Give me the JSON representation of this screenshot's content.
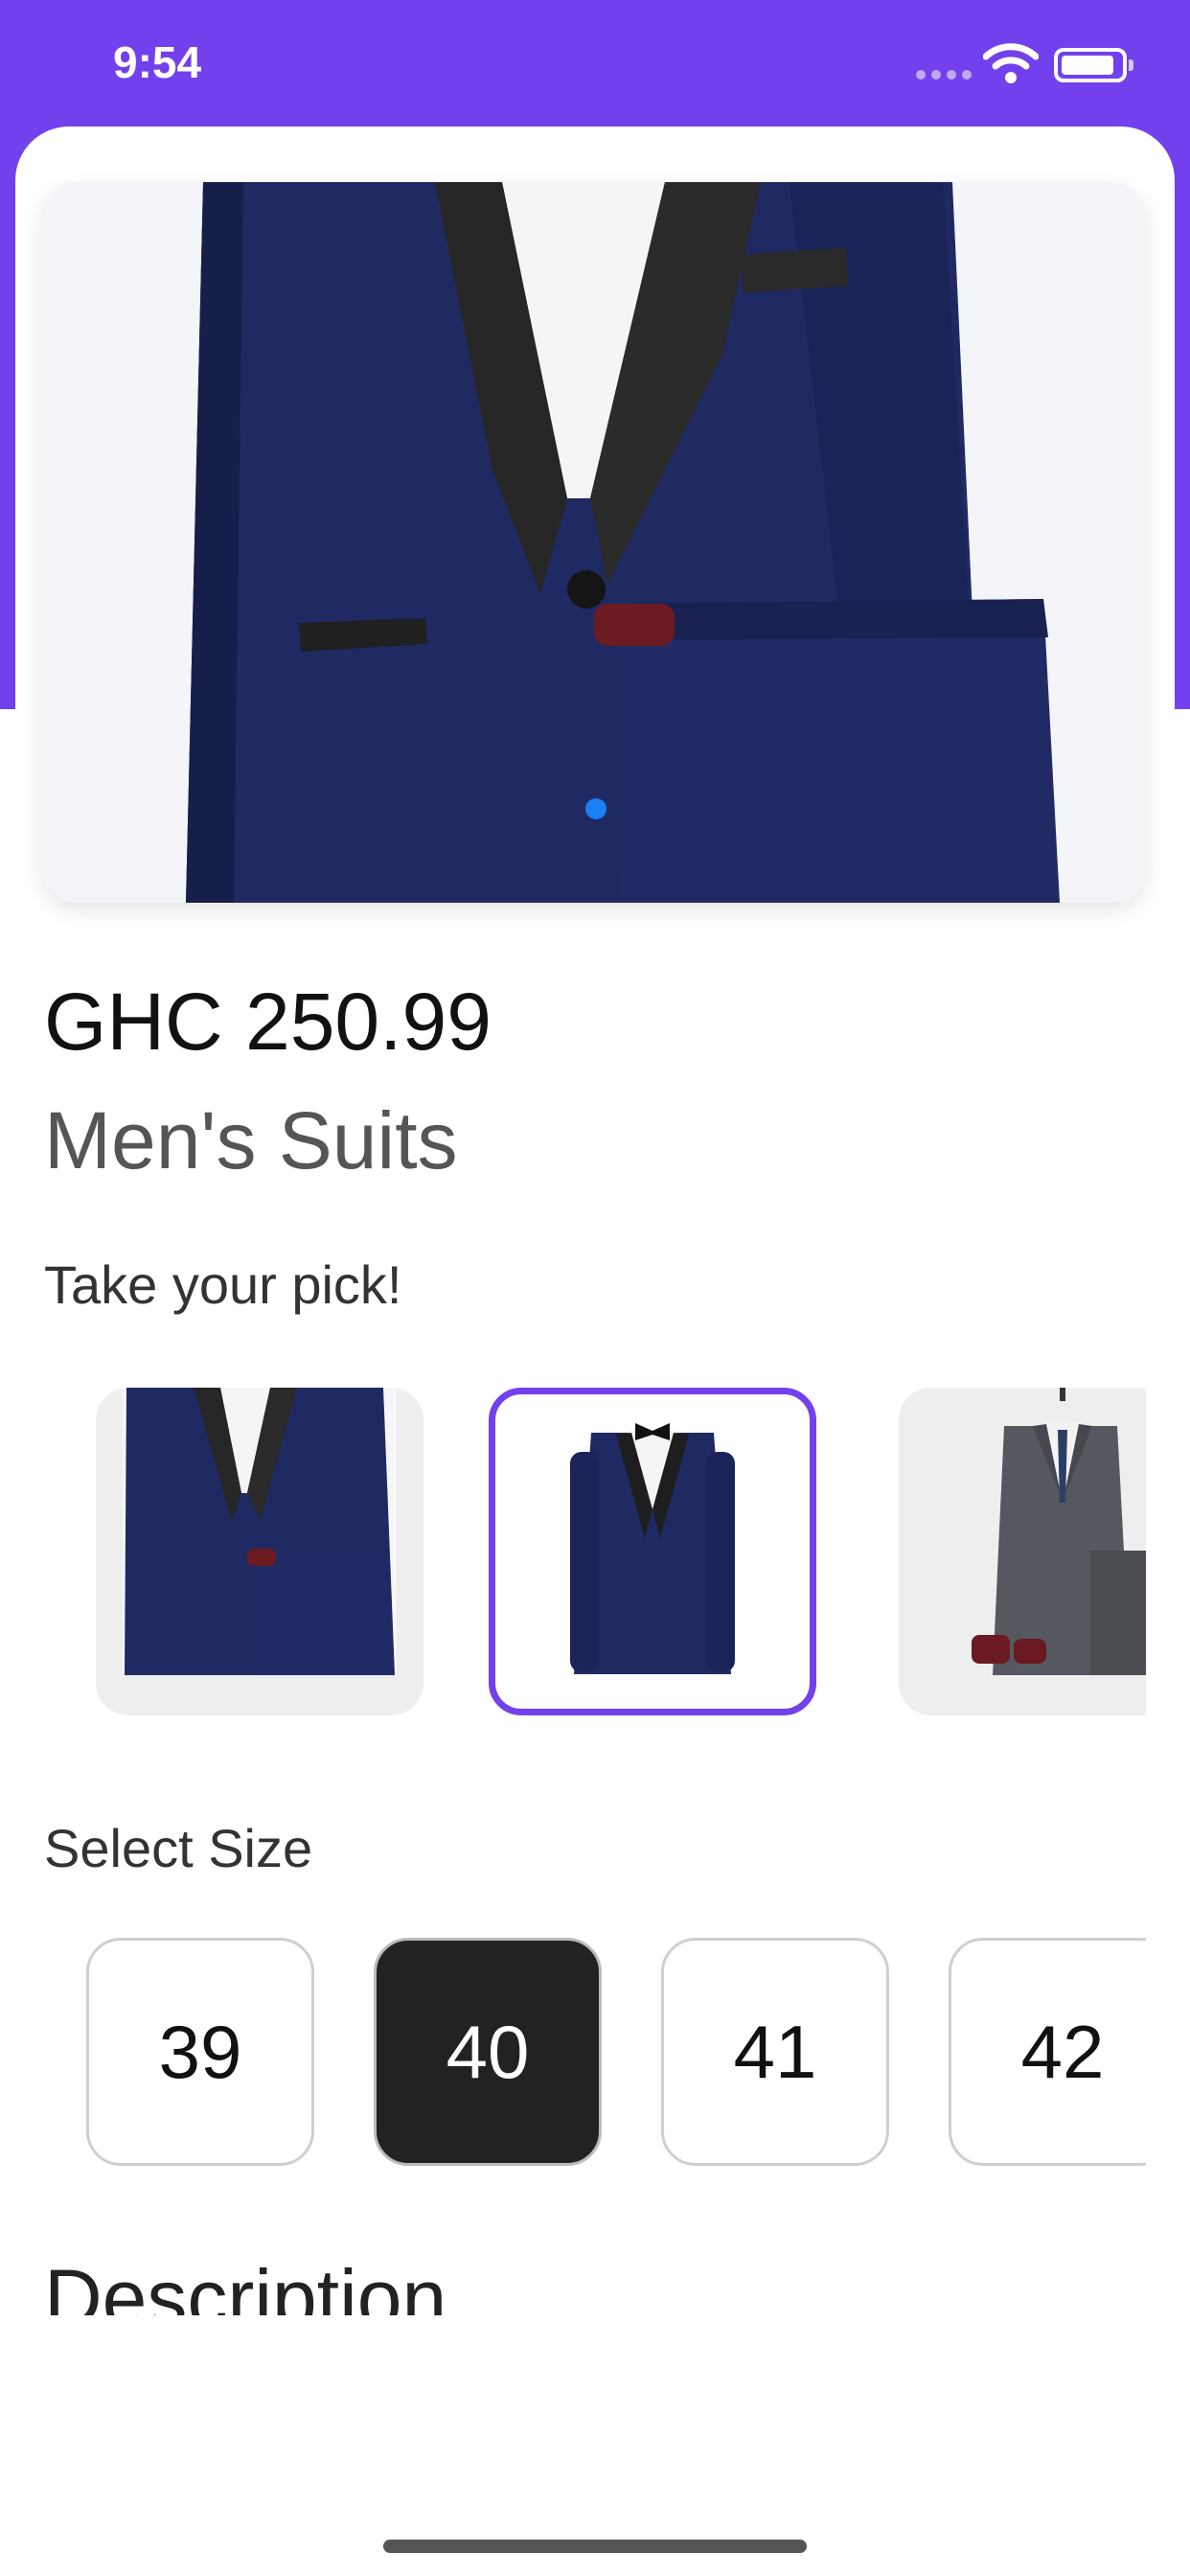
{
  "status_bar": {
    "time": "9:54",
    "icons": [
      "cellular-signal-icon",
      "wifi-icon",
      "battery-icon"
    ]
  },
  "colors": {
    "accent": "#7240EC",
    "page_dot": "#1A7EF5",
    "selected_size_bg": "#222222",
    "suit_navy": "#1F2A63",
    "suit_grey": "#55585E"
  },
  "product": {
    "image": "navy-tuxedo-with-trousers-photo",
    "image_carousel": {
      "current_page": 1
    },
    "price": "GHC 250.99",
    "name": "Men's Suits"
  },
  "variants": {
    "label": "Take your pick!",
    "items": [
      {
        "image": "navy-tuxedo-with-trousers-thumbnail",
        "selected": false
      },
      {
        "image": "navy-tuxedo-with-bow-tie-thumbnail",
        "selected": true
      },
      {
        "image": "grey-suit-with-shoes-thumbnail",
        "selected": false
      }
    ]
  },
  "sizes": {
    "label": "Select Size",
    "options": [
      "39",
      "40",
      "41",
      "42"
    ],
    "selected": "40"
  },
  "description": {
    "title": "Description"
  }
}
